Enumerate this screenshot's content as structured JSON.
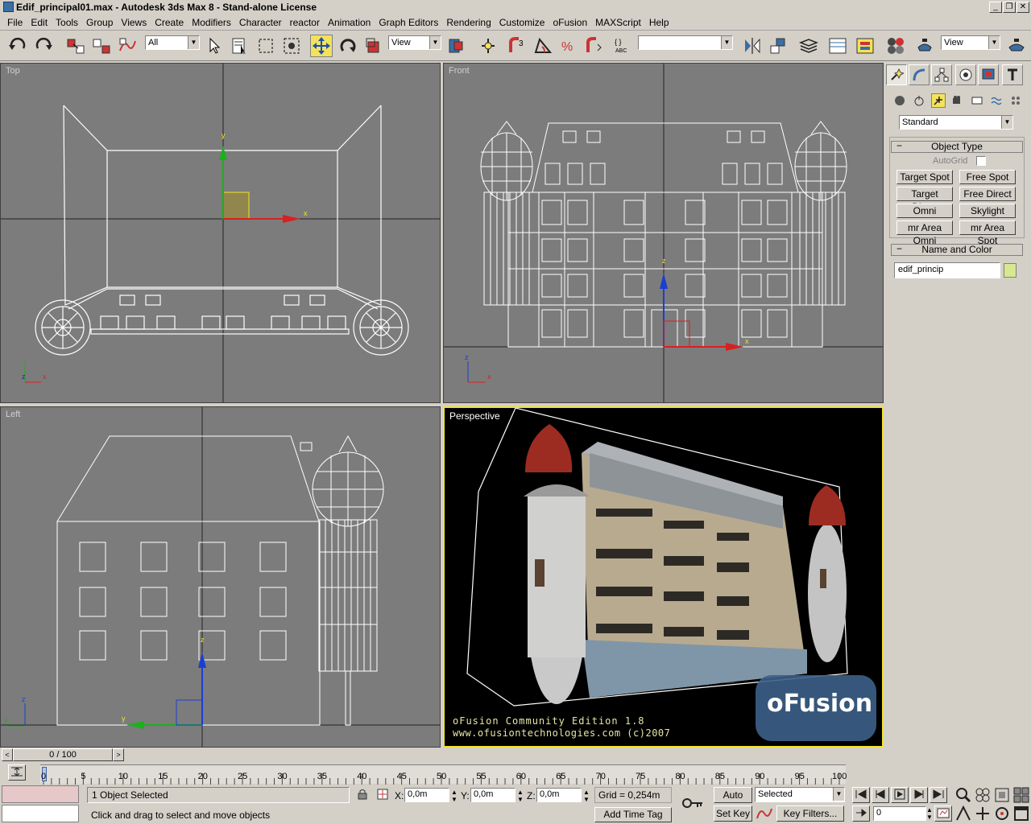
{
  "window": {
    "title": "Edif_principal01.max - Autodesk 3ds Max 8  - Stand-alone License"
  },
  "menu": [
    "File",
    "Edit",
    "Tools",
    "Group",
    "Views",
    "Create",
    "Modifiers",
    "Character",
    "reactor",
    "Animation",
    "Graph Editors",
    "Rendering",
    "Customize",
    "oFusion",
    "MAXScript",
    "Help"
  ],
  "toolbar": {
    "selection_filter": "All",
    "ref_coord": "View",
    "named_sel": "",
    "view_right": "View"
  },
  "viewports": {
    "top": "Top",
    "front": "Front",
    "left": "Left",
    "perspective": "Perspective"
  },
  "overlay": {
    "ofusion_line1": "oFusion Community Edition 1.8",
    "ofusion_line2": "www.ofusiontechnologies.com (c)2007",
    "logo": "oFusion"
  },
  "command_panel": {
    "category": "Standard",
    "object_type_title": "Object Type",
    "autogrid": "AutoGrid",
    "buttons": [
      "Target Spot",
      "Free Spot",
      "Target Direct",
      "Free Direct",
      "Omni",
      "Skylight",
      "mr Area Omni",
      "mr Area Spot"
    ],
    "name_color_title": "Name and Color",
    "object_name": "edif_princip",
    "object_color": "#d8e890"
  },
  "timeline": {
    "slider": "0 / 100",
    "ticks": [
      "0",
      "5",
      "10",
      "15",
      "20",
      "25",
      "30",
      "35",
      "40",
      "45",
      "50",
      "55",
      "60",
      "65",
      "70",
      "75",
      "80",
      "85",
      "90",
      "95",
      "100"
    ]
  },
  "status": {
    "selected": "1 Object Selected",
    "prompt": "Click and drag to select and move objects",
    "x_label": "X:",
    "x": "0,0m",
    "y_label": "Y:",
    "y": "0,0m",
    "z_label": "Z:",
    "z": "0,0m",
    "grid": "Grid = 0,254m",
    "add_time_tag": "Add Time Tag"
  },
  "anim": {
    "auto_key": "Auto Key",
    "set_key": "Set Key",
    "key_mode": "Selected",
    "key_filters": "Key Filters...",
    "frame": "0"
  }
}
